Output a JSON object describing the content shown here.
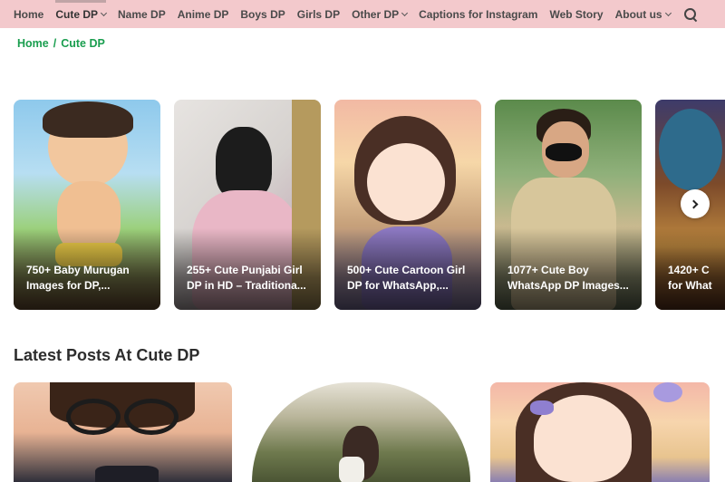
{
  "nav": {
    "items": [
      {
        "label": "Home",
        "has_dropdown": false,
        "active": false
      },
      {
        "label": "Cute DP",
        "has_dropdown": true,
        "active": true
      },
      {
        "label": "Name DP",
        "has_dropdown": false,
        "active": false
      },
      {
        "label": "Anime DP",
        "has_dropdown": false,
        "active": false
      },
      {
        "label": "Boys DP",
        "has_dropdown": false,
        "active": false
      },
      {
        "label": "Girls DP",
        "has_dropdown": false,
        "active": false
      },
      {
        "label": "Other DP",
        "has_dropdown": true,
        "active": false
      },
      {
        "label": "Captions for Instagram",
        "has_dropdown": false,
        "active": false
      },
      {
        "label": "Web Story",
        "has_dropdown": false,
        "active": false
      },
      {
        "label": "About us",
        "has_dropdown": true,
        "active": false
      }
    ],
    "search_icon": "search-icon",
    "background": "#f3c9cc"
  },
  "breadcrumb": {
    "home": "Home",
    "separator": "/",
    "current": "Cute DP",
    "color": "#1a9e4f"
  },
  "carousel": {
    "cards": [
      {
        "line1": "750+ Baby Murugan",
        "line2": "Images for DP,..."
      },
      {
        "line1": "255+ Cute Punjabi Girl",
        "line2": "DP in HD – Traditiona..."
      },
      {
        "line1": "500+ Cute Cartoon Girl",
        "line2": "DP for WhatsApp,..."
      },
      {
        "line1": "1077+ Cute Boy",
        "line2": "WhatsApp DP Images..."
      },
      {
        "line1": "1420+ C",
        "line2": "for What"
      }
    ],
    "next_icon": "chevron-right-icon",
    "prev_icon": "chevron-left-icon"
  },
  "latest": {
    "title": "Latest Posts At Cute DP"
  }
}
